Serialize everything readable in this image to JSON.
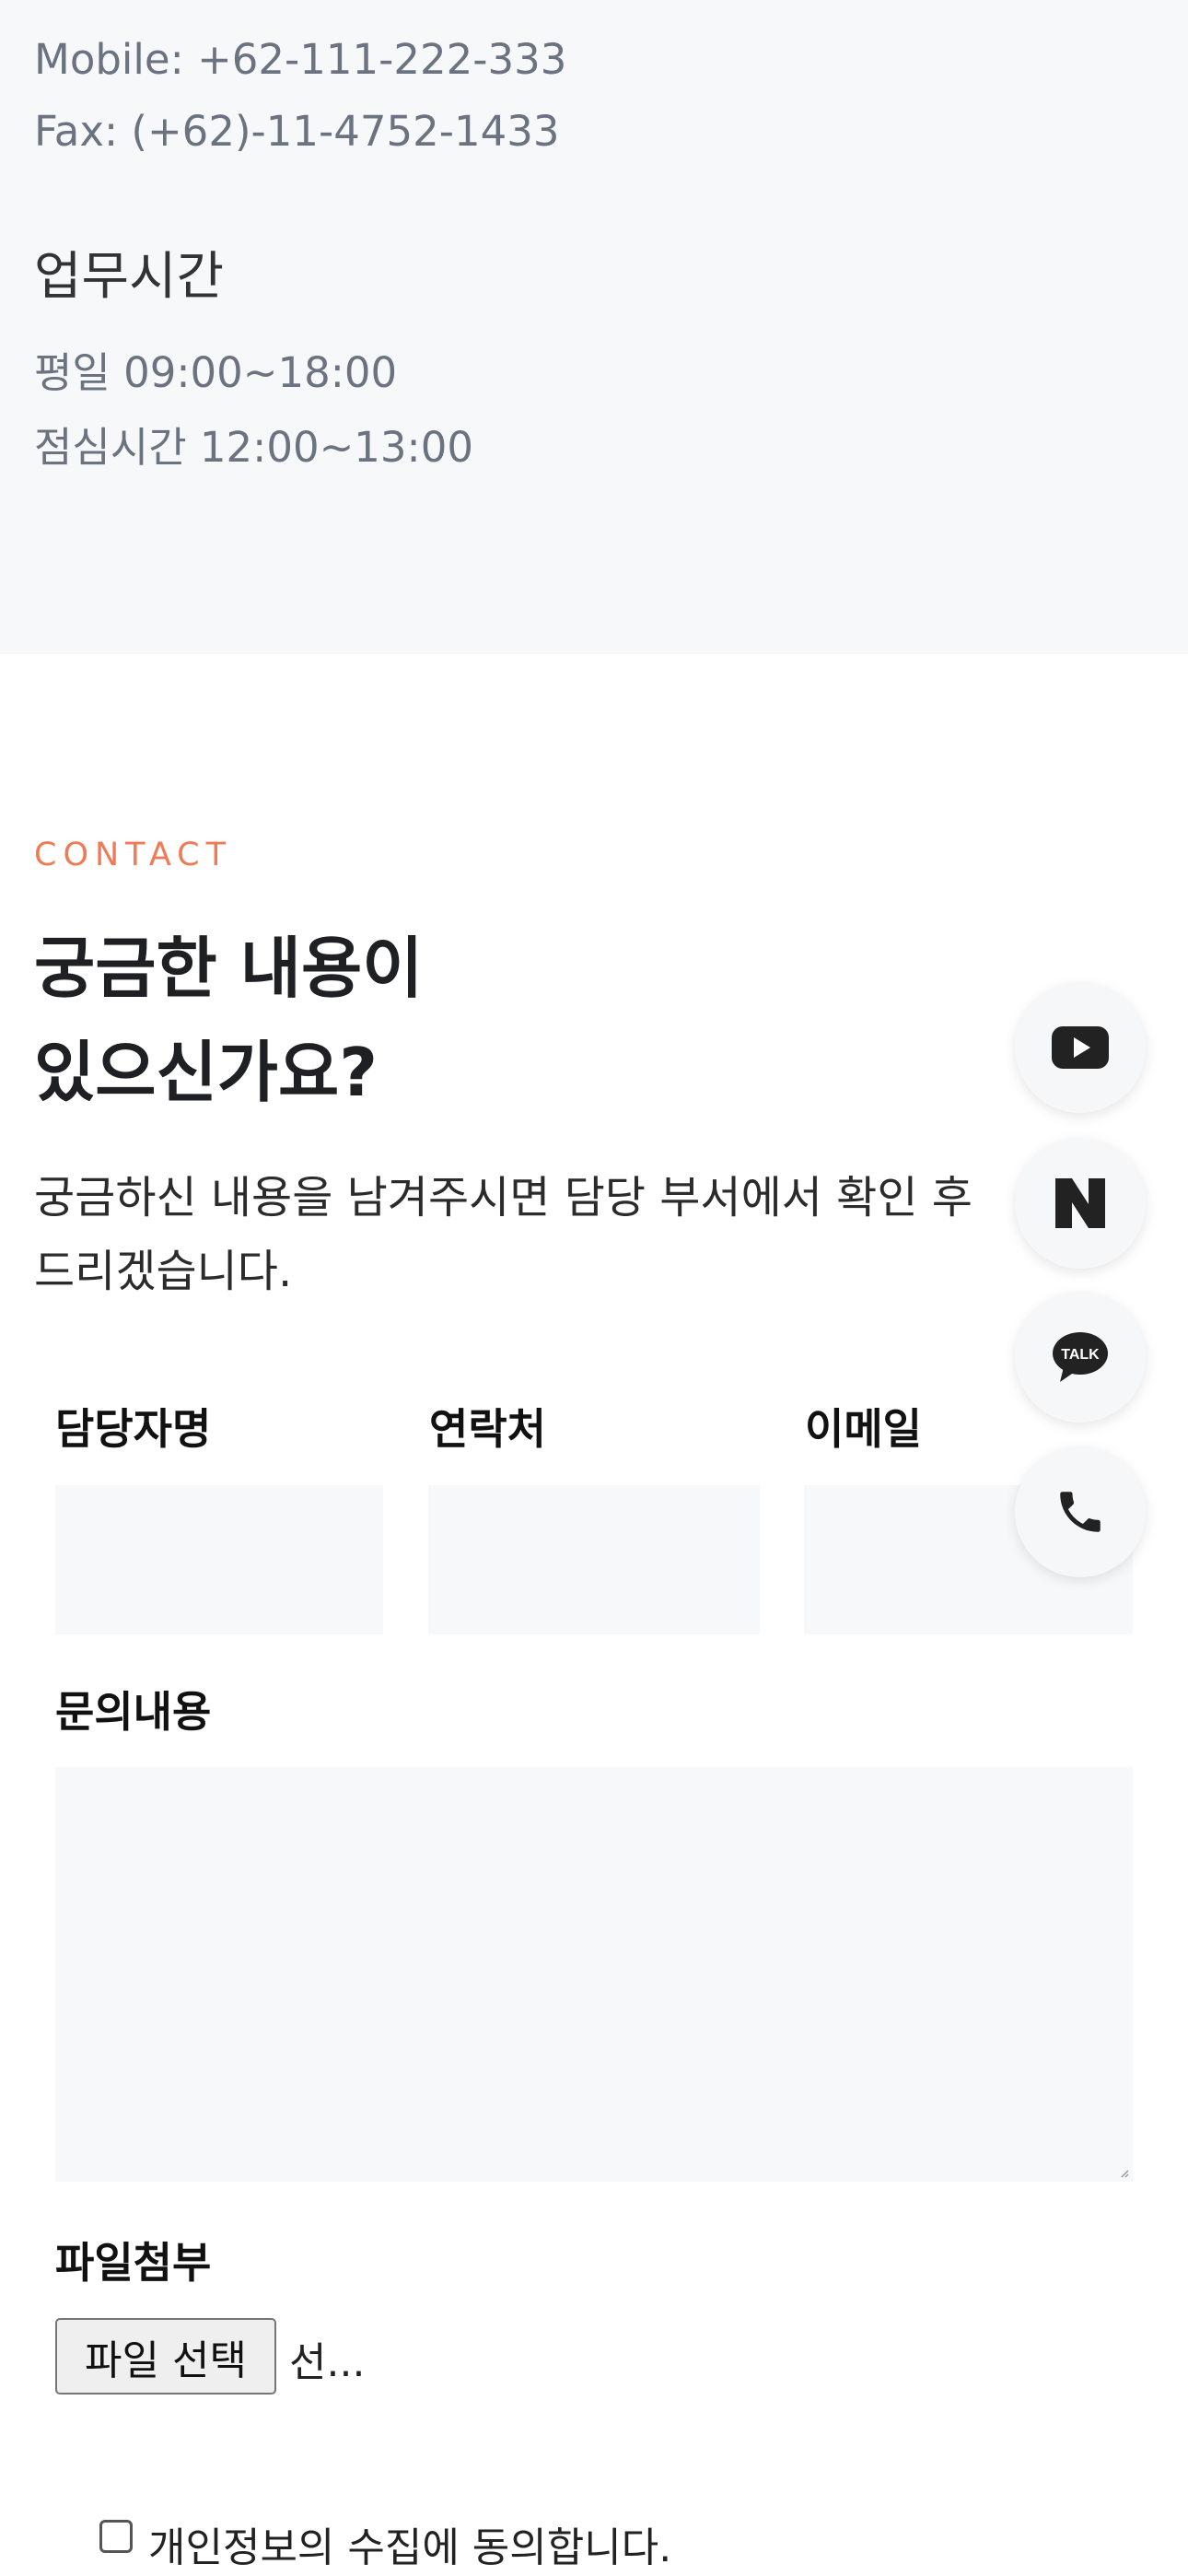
{
  "info": {
    "mobile": "Mobile: +62-111-222-333",
    "fax": "Fax: (+62)-11-4752-1433",
    "hours_title": "업무시간",
    "weekday": "평일 09:00~18:00",
    "lunch": "점심시간 12:00~13:00"
  },
  "contact": {
    "eyebrow": "CONTACT",
    "title_line1": "궁금한 내용이",
    "title_line2": "있으신가요?",
    "desc_line1": "궁금하신 내용을 남겨주시면 담당 부서에서 확인 후",
    "desc_line2": "드리겠습니다."
  },
  "form": {
    "name_label": "담당자명",
    "phone_label": "연락처",
    "email_label": "이메일",
    "name_value": "",
    "phone_value": "",
    "email_value": "",
    "inquiry_label": "문의내용",
    "inquiry_value": "",
    "file_label": "파일첨부",
    "file_button": "파일 선택",
    "file_status": "선...",
    "consent_label": "개인정보의 수집에 동의합니다.",
    "consent_checked": false
  },
  "quick_links": [
    {
      "icon": "youtube-icon"
    },
    {
      "icon": "naver-icon"
    },
    {
      "icon": "kakaotalk-icon",
      "text": "TALK"
    },
    {
      "icon": "phone-icon"
    }
  ],
  "colors": {
    "section_bg": "#f7f8fa",
    "accent": "#f07a56",
    "muted_text": "#6b7280",
    "icon_dark": "#222222"
  }
}
